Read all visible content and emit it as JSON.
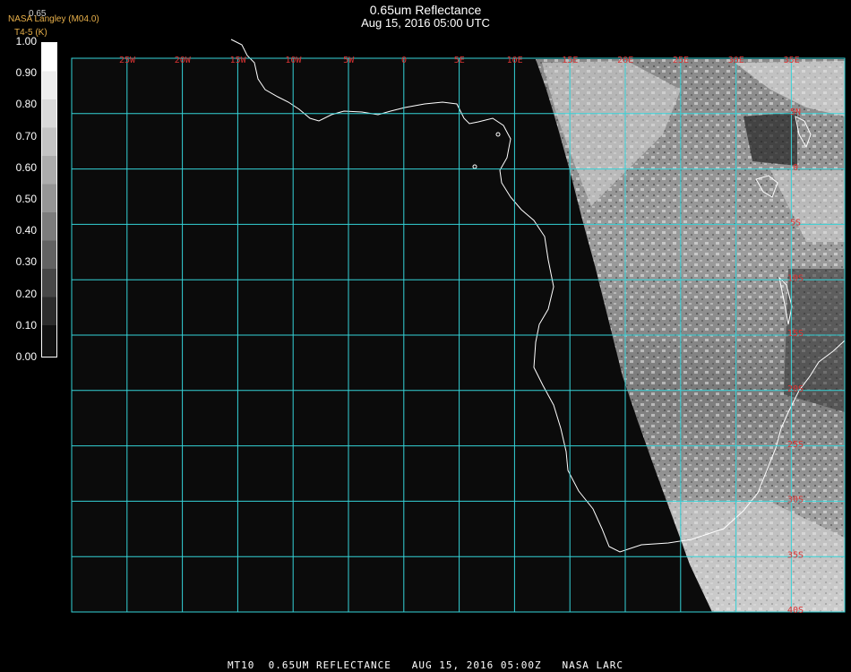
{
  "title": "0.65um Reflectance",
  "subtitle": "Aug 15, 2016 05:00 UTC",
  "org": "NASA Langley (M04.0)",
  "org_sub": "T4-5 (K)",
  "org_top": "0.65",
  "colorbar": {
    "ticks": [
      "1.00",
      "0.90",
      "0.80",
      "0.70",
      "0.60",
      "0.50",
      "0.40",
      "0.30",
      "0.20",
      "0.10",
      "0.00"
    ]
  },
  "map": {
    "lon_labels": [
      "25W",
      "20W",
      "15W",
      "10W",
      "5W",
      "0",
      "5E",
      "10E",
      "15E",
      "20E",
      "25E",
      "30E",
      "35E"
    ],
    "lat_labels": [
      "5N",
      "0",
      "5S",
      "10S",
      "15S",
      "20S",
      "25S",
      "30S",
      "35S",
      "40S"
    ],
    "grid_color": "#35d3d8",
    "label_color": "#dd3333",
    "coast_color": "#ffffff"
  },
  "footer": "MT10  0.65UM REFLECTANCE   AUG 15, 2016 05:00Z   NASA LARC"
}
